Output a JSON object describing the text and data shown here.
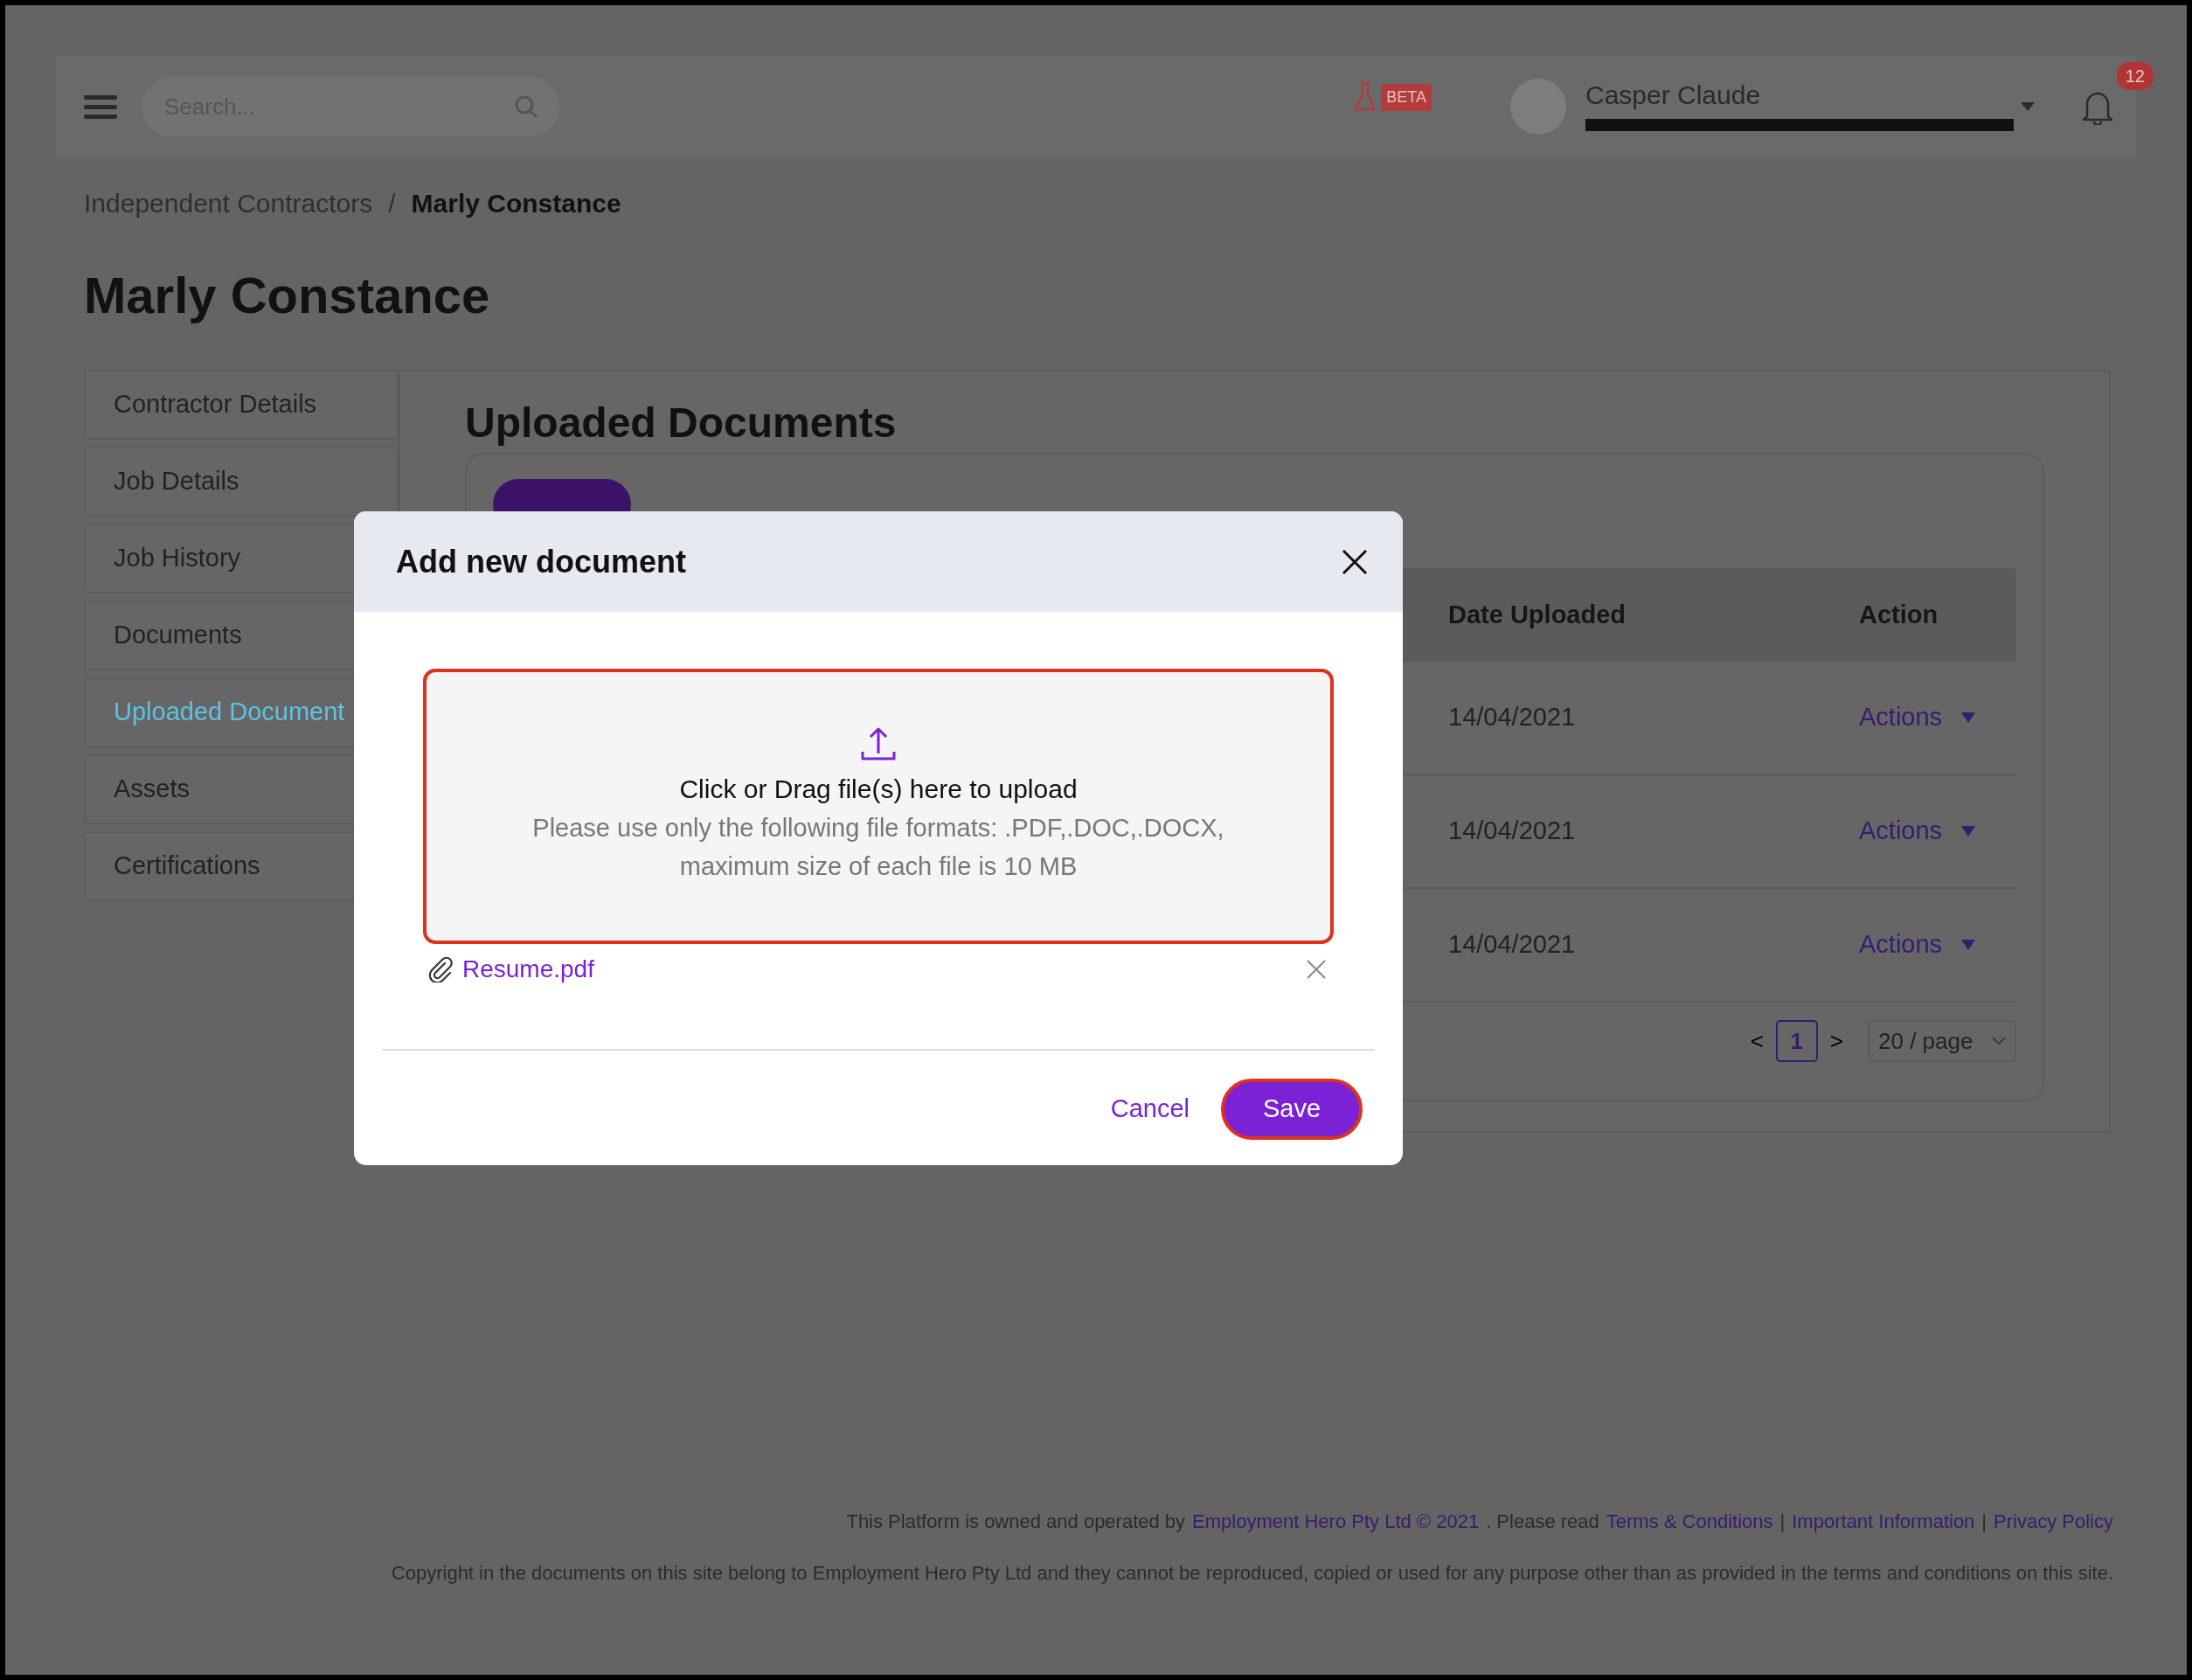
{
  "header": {
    "search": {
      "placeholder": "Search..."
    },
    "beta_badge": "BETA",
    "user": {
      "name": "Casper Claude"
    },
    "notifications": {
      "count": "12"
    }
  },
  "breadcrumb": {
    "separator": "/",
    "items": [
      {
        "label": "Independent Contractors",
        "current": false
      },
      {
        "label": "Marly Constance",
        "current": true
      }
    ]
  },
  "page_title": "Marly Constance",
  "sidebar": {
    "items": [
      {
        "label": "Contractor Details",
        "selected": false
      },
      {
        "label": "Job Details",
        "selected": false
      },
      {
        "label": "Job History",
        "selected": false
      },
      {
        "label": "Documents",
        "selected": false
      },
      {
        "label": "Uploaded Document",
        "selected": true
      },
      {
        "label": "Assets",
        "selected": false
      },
      {
        "label": "Certifications",
        "selected": false
      }
    ]
  },
  "section_title": "Uploaded Documents",
  "table": {
    "columns": [
      "Date Uploaded",
      "Action"
    ],
    "rows": [
      {
        "date": "14/04/2021",
        "action": "Actions"
      },
      {
        "date": "14/04/2021",
        "action": "Actions"
      },
      {
        "date": "14/04/2021",
        "action": "Actions"
      }
    ]
  },
  "pagination": {
    "prev": "<",
    "pages": [
      {
        "label": "1",
        "selected": true
      }
    ],
    "next": ">",
    "page_size": "20 / page"
  },
  "modal": {
    "title": "Add new document",
    "dropzone": {
      "title": "Click or Drag file(s) here to upload",
      "hint": "Please use only the following file formats: .PDF,.DOC,.DOCX, maximum size of each file is 10 MB"
    },
    "attachments": [
      {
        "name": "Resume.pdf"
      }
    ],
    "buttons": {
      "cancel": "Cancel",
      "save": "Save"
    }
  },
  "footer": {
    "notice": [
      {
        "kind": "text",
        "text": "This Platform is owned and operated by"
      },
      {
        "kind": "link",
        "text": "Employment Hero Pty Ltd © 2021"
      },
      {
        "kind": "text",
        "text": ". Please read"
      },
      {
        "kind": "link",
        "text": "Terms & Conditions"
      },
      {
        "kind": "text",
        "text": "|"
      },
      {
        "kind": "link",
        "text": "Important Information"
      },
      {
        "kind": "text",
        "text": "|"
      },
      {
        "kind": "link",
        "text": "Privacy Policy"
      }
    ],
    "copyright": "Copyright in the documents on this site belong to Employment Hero Pty Ltd and they cannot be reproduced, copied or used for any purpose other than as provided in the terms and conditions on this site."
  }
}
